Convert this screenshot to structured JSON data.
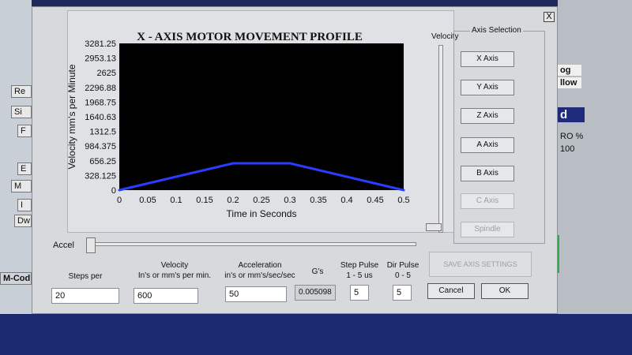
{
  "background": {
    "left_buttons": [
      "Re",
      "Si",
      "F",
      "E",
      "M",
      "I",
      "Dw",
      "M-Cod"
    ],
    "right_texts": [
      "og",
      "llow",
      "d",
      "RO %",
      "100"
    ]
  },
  "dialog": {
    "close_label": "X",
    "chart_data": {
      "type": "line",
      "title": "X - AXIS MOTOR MOVEMENT PROFILE",
      "xlabel": "Time in Seconds",
      "ylabel": "Velocity mm's per Minute",
      "x_ticks": [
        "0",
        "0.05",
        "0.1",
        "0.15",
        "0.2",
        "0.25",
        "0.3",
        "0.35",
        "0.4",
        "0.45",
        "0.5"
      ],
      "y_ticks": [
        "0",
        "328.125",
        "656.25",
        "984.375",
        "1312.5",
        "1640.63",
        "1968.75",
        "2296.88",
        "2625",
        "2953.13",
        "3281.25"
      ],
      "xlim": [
        0,
        0.5
      ],
      "ylim": [
        0,
        3281.25
      ],
      "series": [
        {
          "color": "#2a3cff",
          "x": [
            0,
            0.2,
            0.3,
            0.5
          ],
          "y": [
            0,
            600,
            600,
            0
          ]
        }
      ],
      "plot_bg": "#000000"
    },
    "velocity_slider_label": "Velocity",
    "axis_selection": {
      "title": "Axis Selection",
      "buttons": [
        "X Axis",
        "Y Axis",
        "Z Axis",
        "A Axis",
        "B Axis",
        "C Axis",
        "Spindle"
      ],
      "disabled": [
        "C Axis",
        "Spindle"
      ]
    },
    "accel_label": "Accel",
    "save_button": "SAVE AXIS SETTINGS",
    "fields": {
      "steps_per": {
        "label": "Steps per",
        "value": "20"
      },
      "velocity": {
        "label_line1": "Velocity",
        "label_line2": "In's or mm's per min.",
        "value": "600"
      },
      "acceleration": {
        "label_line1": "Acceleration",
        "label_line2": "in's or mm's/sec/sec",
        "value": "50"
      },
      "gs": {
        "label": "G's",
        "value": "0.005098"
      },
      "step_pulse": {
        "label_line1": "Step Pulse",
        "label_line2": "1 - 5 us",
        "value": "5"
      },
      "dir_pulse": {
        "label_line1": "Dir Pulse",
        "label_line2": "0 - 5",
        "value": "5"
      }
    },
    "cancel_button": "Cancel",
    "ok_button": "OK"
  }
}
